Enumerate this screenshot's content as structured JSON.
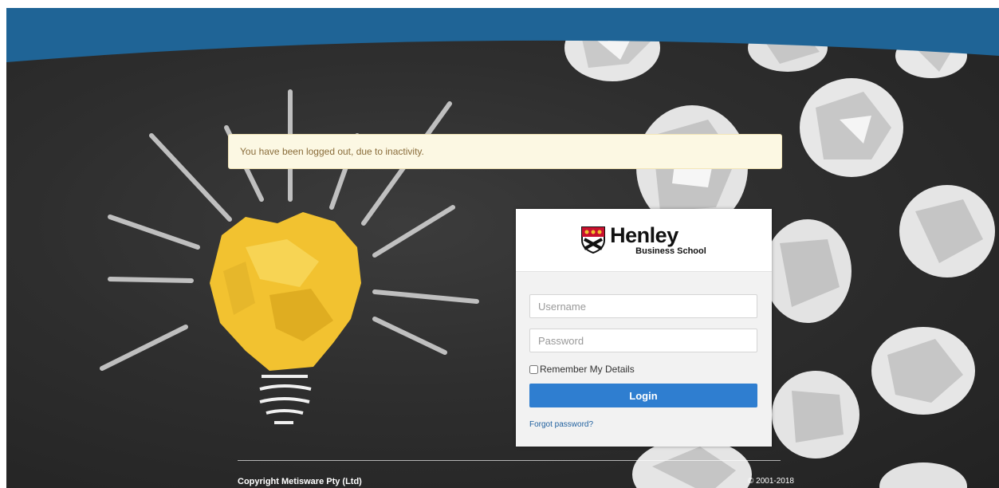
{
  "alert": {
    "message": "You have been logged out, due to inactivity."
  },
  "brand": {
    "name": "Henley",
    "subtitle": "Business School",
    "crest_icon": "shield-crest-icon"
  },
  "login": {
    "username_placeholder": "Username",
    "username_value": "",
    "password_placeholder": "Password",
    "password_value": "",
    "remember_label": "Remember My Details",
    "remember_checked": false,
    "button_label": "Login",
    "forgot_label": "Forgot password?"
  },
  "footer": {
    "copyright": "Copyright Metisware Pty (Ltd)",
    "years": "© 2001-2018"
  },
  "colors": {
    "header_blue": "#1f6496",
    "button_blue": "#2f7ed0",
    "alert_bg": "#fcf8e3",
    "alert_text": "#8a6d3b",
    "bulb_yellow": "#f2c230"
  }
}
